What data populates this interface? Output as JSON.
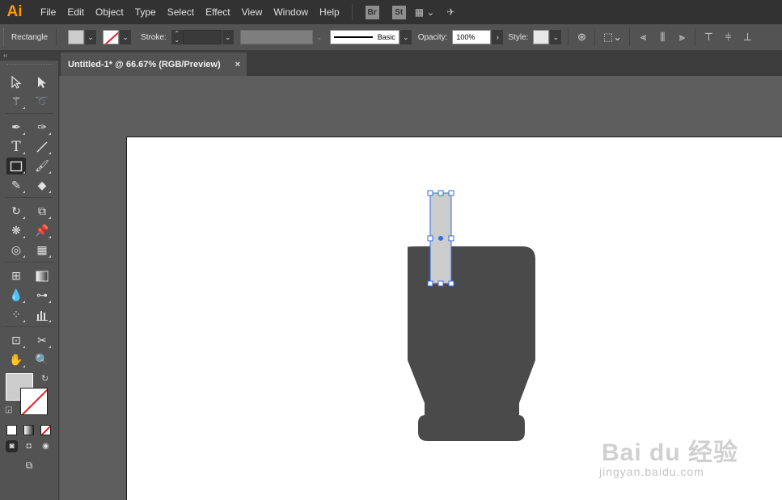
{
  "app": {
    "logo": "Ai"
  },
  "menu": [
    "File",
    "Edit",
    "Object",
    "Type",
    "Select",
    "Effect",
    "View",
    "Window",
    "Help"
  ],
  "menubar_icons": {
    "bridge": "Br",
    "stock": "St"
  },
  "control": {
    "tool_name": "Rectangle",
    "stroke_label": "Stroke:",
    "brush_label": "Basic",
    "opacity_label": "Opacity:",
    "opacity_value": "100%",
    "style_label": "Style:"
  },
  "document": {
    "tab_title": "Untitled-1* @ 66.67% (RGB/Preview)",
    "close_glyph": "×"
  },
  "colors": {
    "fill": "#CCCCCC",
    "stroke": "none",
    "shape": "#4A4A4A",
    "selection": "#2D6EE8",
    "accent_logo": "#FF9A00"
  },
  "watermark": {
    "main": "Bai du 经验",
    "sub": "jingyan.baidu.com"
  }
}
